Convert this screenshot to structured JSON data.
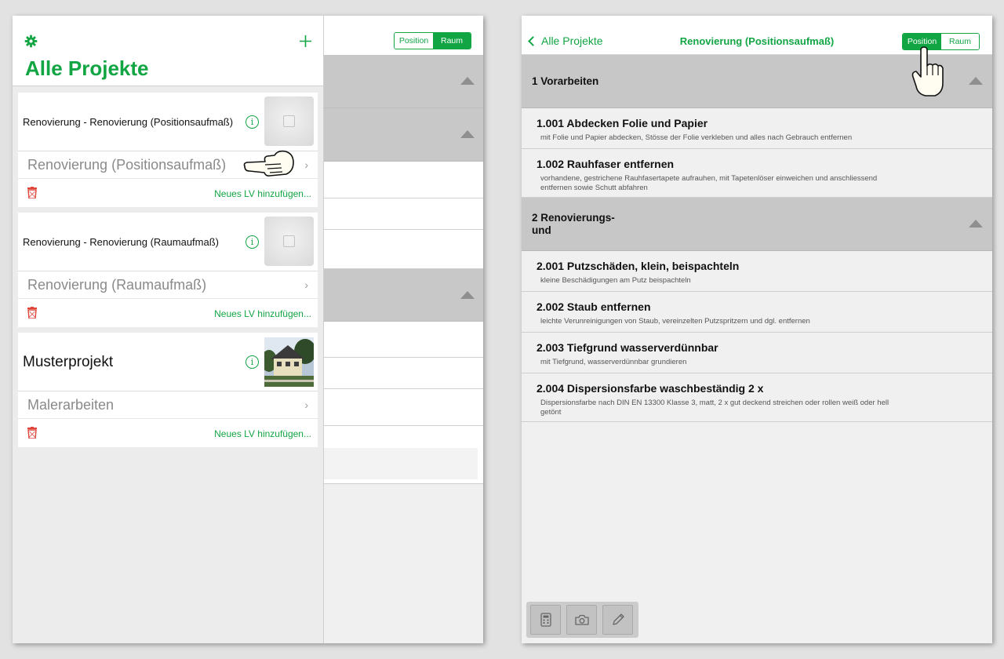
{
  "left": {
    "back_segment": {
      "position": "Position",
      "raum": "Raum",
      "active": "Raum"
    },
    "header": {
      "title": "Alle Projekte",
      "settings_icon": "gear-icon",
      "add_icon": "plus-icon"
    },
    "projects": [
      {
        "name": "Renovierung - Renovierung (Positionsaufmaß)",
        "thumb": "placeholder-image",
        "lv": "Renovierung (Positionsaufmaß)",
        "add_lv": "Neues LV hinzufügen..."
      },
      {
        "name": "Renovierung - Renovierung (Raumaufmaß)",
        "thumb": "placeholder-image",
        "lv": "Renovierung (Raumaufmaß)",
        "add_lv": "Neues LV hinzufügen..."
      },
      {
        "name": "Musterprojekt",
        "thumb": "house-photo",
        "lv": "Malerarbeiten",
        "add_lv": "Neues LV hinzufügen..."
      }
    ]
  },
  "right": {
    "nav": {
      "back_label": "Alle Projekte",
      "title": "Renovierung (Positionsaufmaß)"
    },
    "segment": {
      "position": "Position",
      "raum": "Raum",
      "active": "Position"
    },
    "sections": [
      {
        "title": "1 Vorarbeiten",
        "items": [
          {
            "title": "1.001 Abdecken Folie und Papier",
            "desc": "mit Folie und Papier abdecken, Stösse der Folie verkleben und alles nach Gebrauch entfernen"
          },
          {
            "title": "1.002 Rauhfaser entfernen",
            "desc": "vorhandene, gestrichene Rauhfasertapete aufrauhen, mit Tapetenlöser einweichen und anschliessend entfernen sowie Schutt abfahren"
          }
        ]
      },
      {
        "title_line1": "2 Renovierungs-",
        "title_line2": "und",
        "items": [
          {
            "title": "2.001 Putzschäden, klein, beispachteln",
            "desc": "kleine Beschädigungen am Putz beispachteln"
          },
          {
            "title": "2.002 Staub entfernen",
            "desc": "leichte Verunreinigungen von Staub, vereinzelten Putzspritzern und dgl. entfernen"
          },
          {
            "title": "2.003 Tiefgrund wasserverdünnbar",
            "desc": "mit Tiefgrund, wasserverdünnbar grundieren"
          },
          {
            "title": "2.004 Dispersionsfarbe waschbeständig 2 x",
            "desc": "Dispersionsfarbe nach DIN EN 13300 Klasse 3, matt, 2 x gut deckend streichen oder rollen weiß oder hell getönt"
          }
        ]
      }
    ],
    "toolbar": [
      "calculator-icon",
      "camera-icon",
      "pencil-icon"
    ]
  },
  "colors": {
    "accent": "#12a544",
    "section_bg": "#c7c7c7",
    "trash": "#e0453a"
  }
}
